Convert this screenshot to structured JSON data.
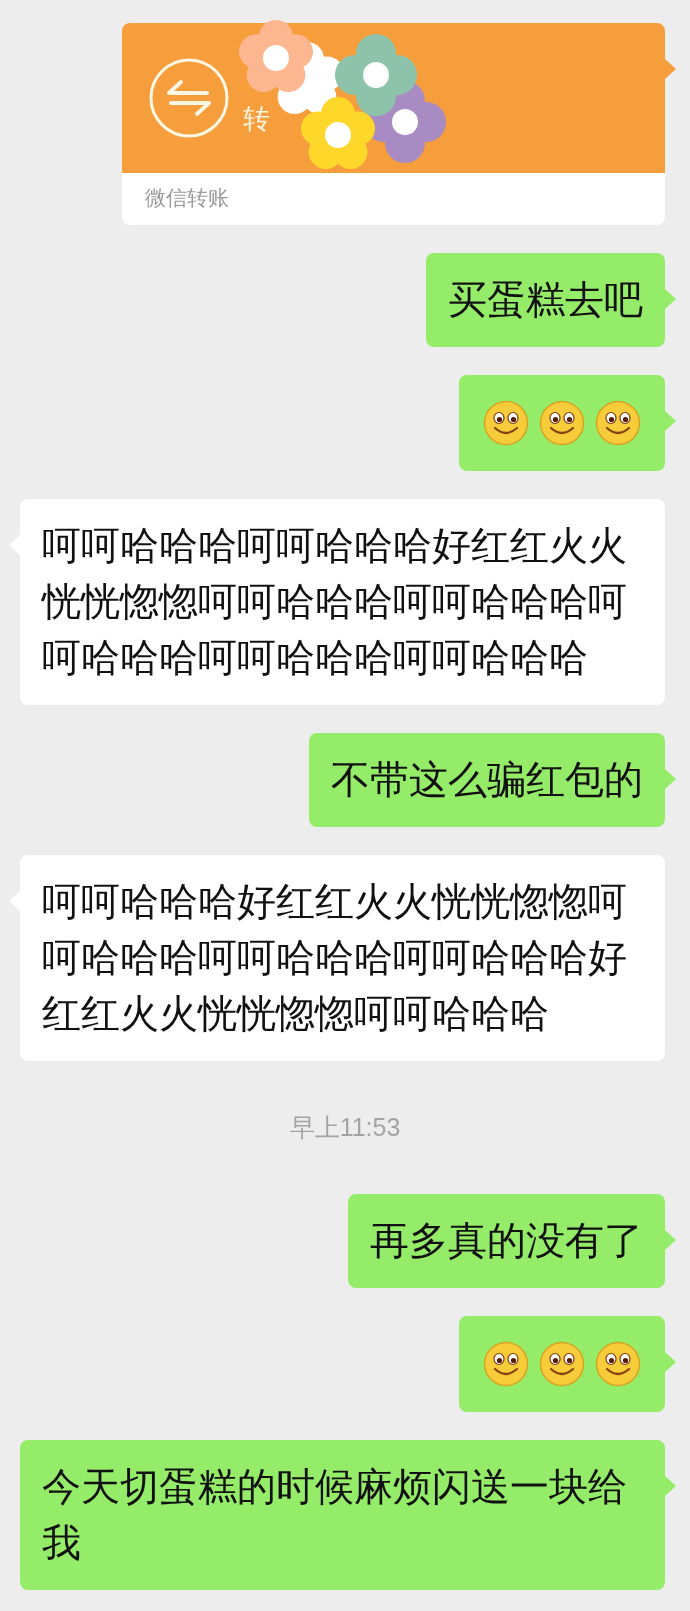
{
  "messages": [
    {
      "kind": "transfer",
      "outgoing": true,
      "title": "转",
      "footer": "微信转账",
      "covered": true
    },
    {
      "kind": "text",
      "outgoing": true,
      "text": "买蛋糕去吧"
    },
    {
      "kind": "emoji",
      "outgoing": true,
      "emojis": [
        {
          "kind": "smile"
        },
        {
          "kind": "smile"
        },
        {
          "kind": "smile"
        }
      ]
    },
    {
      "kind": "text",
      "outgoing": false,
      "text": "呵呵哈哈哈呵呵哈哈哈好红红火火恍恍惚惚呵呵哈哈哈呵呵哈哈哈呵呵哈哈哈呵呵哈哈哈呵呵哈哈哈"
    },
    {
      "kind": "text",
      "outgoing": true,
      "text": "不带这么骗红包的"
    },
    {
      "kind": "text",
      "outgoing": false,
      "text": "呵呵哈哈哈好红红火火恍恍惚惚呵呵哈哈哈呵呵哈哈哈呵呵哈哈哈好红红火火恍恍惚惚呵呵哈哈哈"
    },
    {
      "kind": "time",
      "text": "早上11:53"
    },
    {
      "kind": "text",
      "outgoing": true,
      "text": "再多真的没有了"
    },
    {
      "kind": "emoji",
      "outgoing": true,
      "emojis": [
        {
          "kind": "smile"
        },
        {
          "kind": "smile"
        },
        {
          "kind": "smile"
        }
      ]
    },
    {
      "kind": "text",
      "outgoing": true,
      "text": "今天切蛋糕的时候麻烦闪送一块给我"
    }
  ]
}
